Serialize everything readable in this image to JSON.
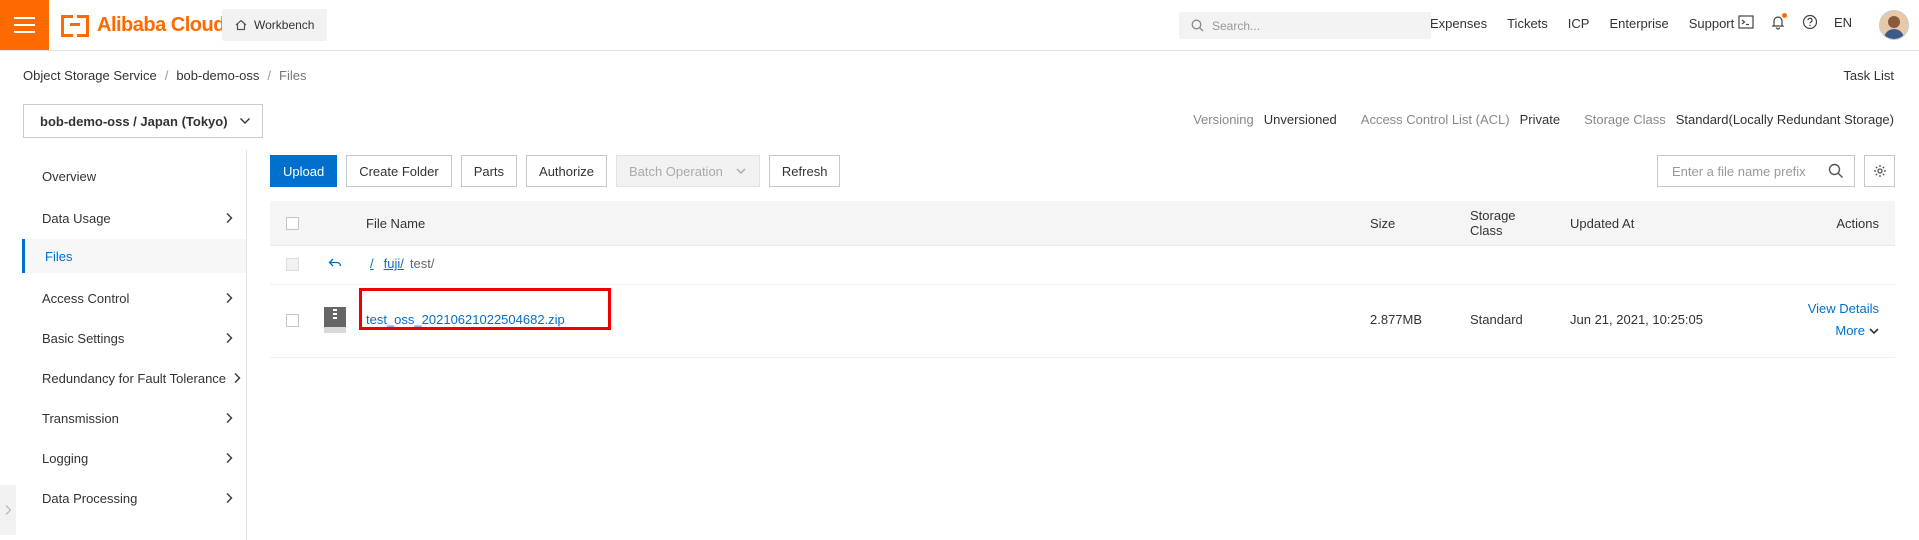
{
  "header": {
    "logo_text": "Alibaba Cloud",
    "workbench_label": "Workbench",
    "search_placeholder": "Search...",
    "nav_links": [
      "Expenses",
      "Tickets",
      "ICP",
      "Enterprise",
      "Support"
    ],
    "language": "EN",
    "brand_color": "#ff6a00"
  },
  "breadcrumb": {
    "items": [
      "Object Storage Service",
      "bob-demo-oss",
      "Files"
    ],
    "separator": "/"
  },
  "task_list_label": "Task List",
  "bucket": {
    "selected": "bob-demo-oss / Japan (Tokyo)"
  },
  "bucket_meta": {
    "versioning_label": "Versioning",
    "versioning_value": "Unversioned",
    "acl_label": "Access Control List (ACL)",
    "acl_value": "Private",
    "storage_class_label": "Storage Class",
    "storage_class_value": "Standard(Locally Redundant Storage)"
  },
  "sidebar": {
    "items": [
      {
        "label": "Overview"
      },
      {
        "label": "Data Usage"
      },
      {
        "label": "Files"
      },
      {
        "label": "Access Control"
      },
      {
        "label": "Basic Settings"
      },
      {
        "label": "Redundancy for Fault Tolerance"
      },
      {
        "label": "Transmission"
      },
      {
        "label": "Logging"
      },
      {
        "label": "Data Processing"
      }
    ],
    "active": "Files"
  },
  "toolbar": {
    "upload": "Upload",
    "create_folder": "Create Folder",
    "parts": "Parts",
    "authorize": "Authorize",
    "batch_operation": "Batch Operation",
    "refresh": "Refresh",
    "prefix_placeholder": "Enter a file name prefix"
  },
  "table": {
    "columns": {
      "file_name": "File Name",
      "size": "Size",
      "storage_class": "Storage Class",
      "updated_at": "Updated At",
      "actions": "Actions"
    },
    "path": {
      "root": "/",
      "folder": "fuji/",
      "current": "test/"
    },
    "rows": [
      {
        "name": "test_oss_20210621022504682.zip",
        "size": "2.877MB",
        "storage_class": "Standard",
        "updated_at": "Jun 21, 2021, 10:25:05",
        "action_primary": "View Details",
        "action_more": "More"
      }
    ]
  }
}
